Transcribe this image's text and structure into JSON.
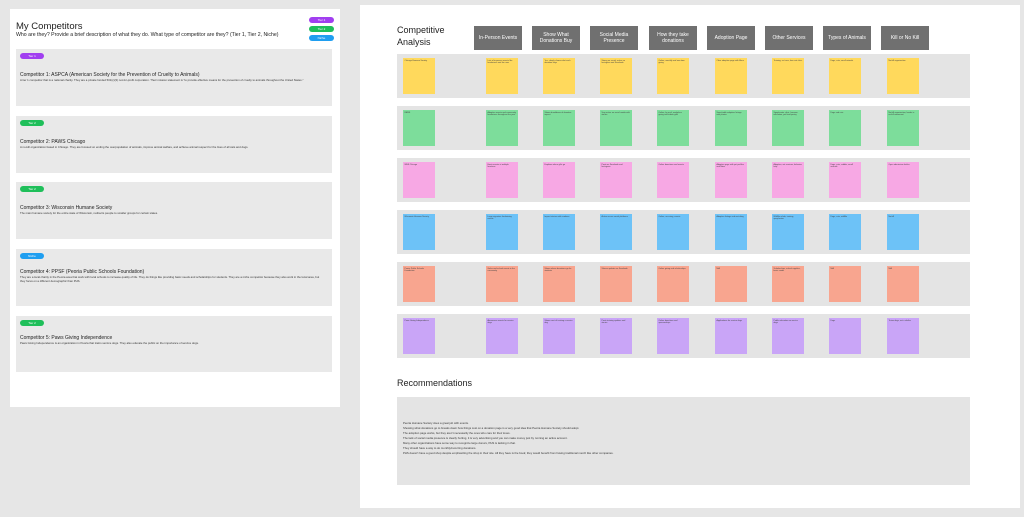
{
  "left": {
    "title": "My Competitors",
    "subtitle": "Who are they? Provide a brief description of what they do. What type of competitor are they? (Tier 1, Tier 2, Niche)",
    "tier_buttons": [
      {
        "label": "Tier 1",
        "color": "#a13ff0"
      },
      {
        "label": "Tier 2",
        "color": "#1fbf5a"
      },
      {
        "label": "Niche",
        "color": "#1f9ef0"
      }
    ],
    "competitors": [
      {
        "tier": "Tier 1",
        "color": "#a13ff0",
        "name": "Competitor 1: ASPCA (American Society for the Prevention of Cruelty to Animals)",
        "desc": "A tier 1 competitor that is a national charity. They are a private funded 501(c)(3) not-for-profit corporation. Their mission statement is \"to provide effective means for the prevention of cruelty to animals throughout the United States.\""
      },
      {
        "tier": "Tier 2",
        "color": "#1fbf5a",
        "name": "Competitor 2: PAWS Chicago",
        "desc": "A no-kill organization based in Chicago. They are focused on ending the overpopulation of animals, improve animal welfare, and achieve animal respect for the lives of all cats and dogs."
      },
      {
        "tier": "Tier 2",
        "color": "#1fbf5a",
        "name": "Competitor 3: Wisconsin Humane Society",
        "desc": "The main humane society for the entire state of Wisconsin, redirects people to smaller groups for certain states."
      },
      {
        "tier": "Niche",
        "color": "#1f9ef0",
        "name": "Competitor 4: PPSF (Peoria Public Schools Foundation)",
        "desc": "They are a local charity in the Peoria area that work with local schools to increase quality of life. They do things like providing basic needs and scholarships for students. They are a niche competitor because they also work in the local area, but they focus on a different demographic than PHS."
      },
      {
        "tier": "Tier 2",
        "color": "#1fbf5a",
        "name": "Competitor 5: Paws Giving Independence",
        "desc": "Paws Giving Independence is an organization in Peoria that trains service dogs. They also educate the public on the importance of service dogs."
      }
    ]
  },
  "right": {
    "title_line1": "Competitive",
    "title_line2": "Analysis",
    "headers": [
      "In-Person Events",
      "Show What Donations Buy",
      "Social Media Presence",
      "How they take donations",
      "Adoption Page",
      "Other Services",
      "Types of Animals",
      "Kill or No Kill"
    ],
    "rows": [
      {
        "color": "#ffd95c",
        "notes": [
          "Chicago Humane Society",
          "Lots of in-person events like fundraisers and fun runs",
          "Yes, clearly shows what each donation buys",
          "Strong on social, active on Instagram and Facebook",
          "Online, monthly and one-time giving",
          "Clear adoption page with filters",
          "Training, vet care, low cost clinic",
          "Dogs, cats, small animals",
          "No-kill organization"
        ]
      },
      {
        "color": "#7ddd9b",
        "notes": [
          "PAWS",
          "Adoption events and community fundraisers throughout the year",
          "Shows breakdown of donation impact",
          "Very active on social media with stories",
          "Online, by mail, workplace giving and tribute gifts",
          "Searchable adoption listings with photos",
          "Spay/neuter clinic, humane education, pet food pantry",
          "Dogs and cats",
          "No-kill organization, leader in no-kill movement"
        ]
      },
      {
        "color": "#f7a8e4",
        "notes": [
          "WHS Chicago",
          "Hosts events at multiple locations",
          "Explains where gifts go",
          "Posts on Facebook and Instagram",
          "Online donations and events",
          "Adoption page with pet profiles and filters",
          "Adoption, vet services, behavior help",
          "Dogs, cats, rabbits, small animals",
          "Open admission shelter"
        ]
      },
      {
        "color": "#6dc2f7",
        "notes": [
          "Wisconsin Humane Society",
          "Large signature fundraising events",
          "Impact stories with numbers",
          "Active across social platforms",
          "Online, recurring, events",
          "Adoption listings and matching",
          "Wildlife rehab, training, spay/neuter",
          "Dogs, cats, wildlife",
          "No-kill"
        ]
      },
      {
        "color": "#f8a58f",
        "notes": [
          "Peoria Public Schools Foundation",
          "Galas and school events in the community",
          "Shows where donations go for students",
          "Shares updates on Facebook",
          "Online giving and scholarships",
          "N/A",
          "Scholarships, school supplies, basic needs",
          "N/A",
          "N/A"
        ]
      },
      {
        "color": "#c9a5f7",
        "notes": [
          "Paws Giving Independence",
          "Awareness events for service dogs",
          "Shows cost of training a service dog",
          "Posts training updates and stories",
          "Online donations and sponsorships",
          "Applications for service dogs",
          "Public education on service dogs",
          "Dogs",
          "Trains dogs, not a shelter"
        ]
      }
    ],
    "recommendations_title": "Recommendations",
    "recommendations": [
      "Peoria Humane Society does a great job with events.",
      "Showing what donations go to breaks down how things cost on a donation page is a very good idea that Peoria Humane Society should adopt.",
      "The adoption page works, but they aren't necessarily the ones who care for their loves.",
      "The lack of social media presence is clearly hurting, it is very advertising and you can make money just by running an active account.",
      "Many other organizations have some way to recognize large donors, PHS is lacking in that.",
      "They should have a way to do monthly/recurring donations.",
      "PHS doesn't have a good shop despite emphasizing the shop in their site. All they have is the book; they would benefit from having traditional merch like other companies."
    ]
  }
}
